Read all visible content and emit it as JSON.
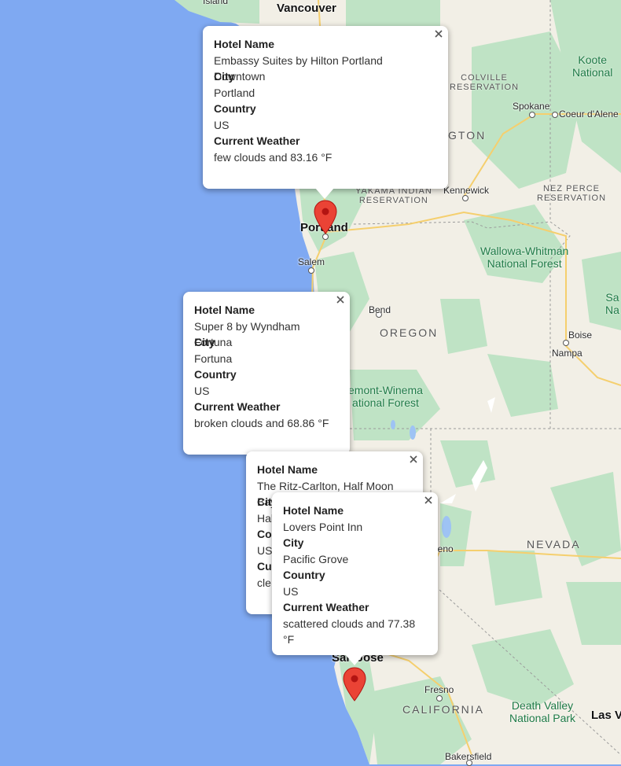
{
  "map": {
    "places": {
      "island": "Island",
      "vancouver": "Vancouver",
      "spokane": "Spokane",
      "coeur_dalene": "Coeur d'Alene",
      "kennewick": "Kennewick",
      "portland": "Portland",
      "salem": "Salem",
      "bend": "Bend",
      "boise": "Boise",
      "nampa": "Nampa",
      "reno": "Reno",
      "san_jose": "San Jose",
      "fresno": "Fresno",
      "bakersfield": "Bakersfield",
      "las_vegas": "Las Ve"
    },
    "states": {
      "washington": "GTON",
      "oregon": "OREGON",
      "nevada": "NEVADA",
      "california": "CALIFORNIA"
    },
    "regions": {
      "colville": [
        "COLVILLE",
        "RESERVATION"
      ],
      "yakama": [
        "YAKAMA INDIAN",
        "RESERVATION"
      ],
      "nez_perce": [
        "NEZ PERCE",
        "RESERVATION"
      ]
    },
    "parks": {
      "kootenai": [
        "Koote",
        "National"
      ],
      "wallowa": [
        "Wallowa-Whitman",
        "National Forest"
      ],
      "fremont": [
        "emont-Winema",
        "ational Forest"
      ],
      "death_valley": [
        "Death Valley",
        "National Park"
      ],
      "sawtooth": [
        "Sa",
        "Na"
      ]
    }
  },
  "info_windows": [
    {
      "id": "portland",
      "hotel_label": "Hotel Name",
      "hotel": "Embassy Suites by Hilton Portland Downtown",
      "city_label": "City",
      "city": "Portland",
      "country_label": "Country",
      "country": "US",
      "weather_label": "Current Weather",
      "weather": "few clouds and 83.16 °F"
    },
    {
      "id": "fortuna",
      "hotel_label": "Hotel Name",
      "hotel": "Super 8 by Wyndham Fortuna",
      "city_label": "City",
      "city": "Fortuna",
      "country_label": "Country",
      "country": "US",
      "weather_label": "Current Weather",
      "weather": "broken clouds and 68.86 °F"
    },
    {
      "id": "halfmoon",
      "hotel_label": "Hotel Name",
      "hotel": "The Ritz-Carlton, Half Moon Bay",
      "city_label": "City",
      "city": "Hal",
      "country_label": "Cou",
      "country": "US",
      "weather_label": "Cur",
      "weather": "cle"
    },
    {
      "id": "pacificgrove",
      "hotel_label": "Hotel Name",
      "hotel": "Lovers Point Inn",
      "city_label": "City",
      "city": "Pacific Grove",
      "country_label": "Country",
      "country": "US",
      "weather_label": "Current Weather",
      "weather": "scattered clouds and 77.38 °F"
    }
  ],
  "colors": {
    "water": "#7fa9f2",
    "land": "#f2efe6",
    "forest": "#bfe3c5",
    "highway": "#f5cf6e",
    "marker": "#ea4335"
  }
}
